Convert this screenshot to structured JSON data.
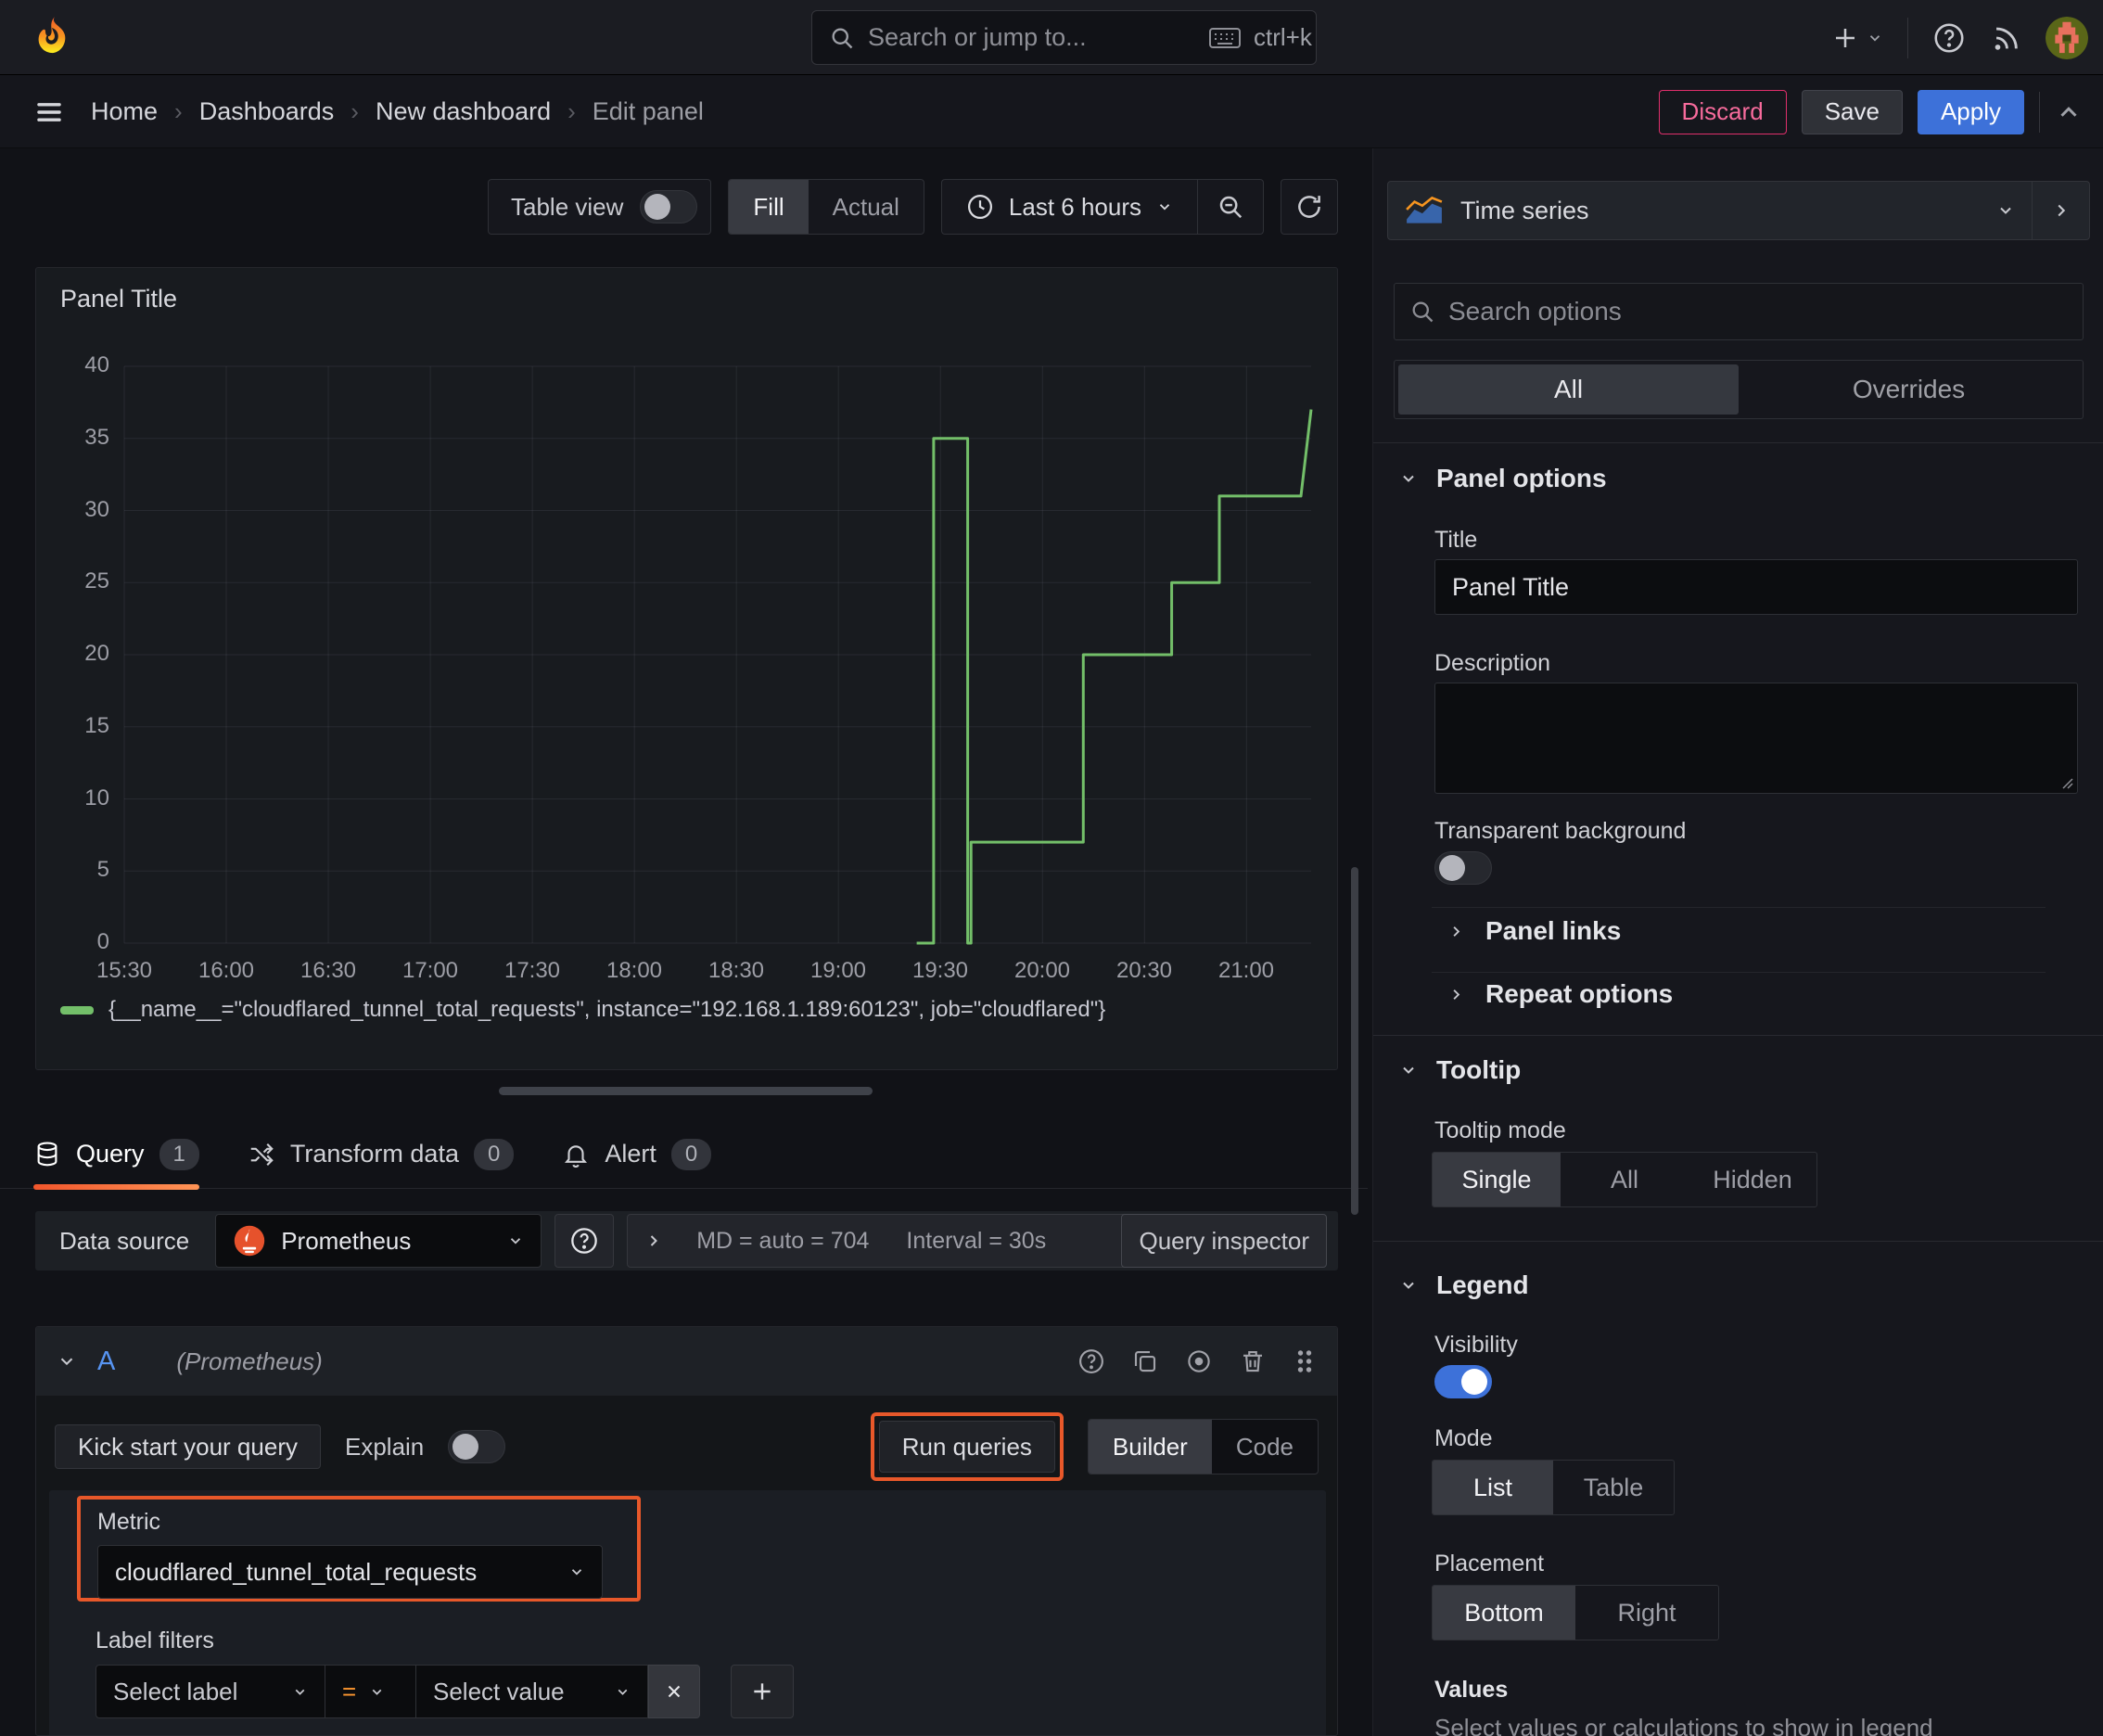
{
  "topbar": {
    "search_placeholder": "Search or jump to...",
    "shortcut": "ctrl+k"
  },
  "breadcrumb": {
    "items": [
      "Home",
      "Dashboards",
      "New dashboard",
      "Edit panel"
    ]
  },
  "header_actions": {
    "discard": "Discard",
    "save": "Save",
    "apply": "Apply"
  },
  "toolbar": {
    "table_view_label": "Table view",
    "fill_label": "Fill",
    "actual_label": "Actual",
    "time_range_label": "Last 6 hours"
  },
  "panel": {
    "title": "Panel Title"
  },
  "chart_data": {
    "type": "line",
    "line_style": "step-after",
    "title": "Panel Title",
    "xlabel": "",
    "ylabel": "",
    "x_ticks": [
      "15:30",
      "16:00",
      "16:30",
      "17:00",
      "17:30",
      "18:00",
      "18:30",
      "19:00",
      "19:30",
      "20:00",
      "20:30",
      "21:00"
    ],
    "x_tick_minutes": [
      0,
      30,
      60,
      90,
      120,
      150,
      180,
      210,
      240,
      270,
      300,
      330
    ],
    "x_range_minutes": [
      0,
      349
    ],
    "y_ticks": [
      0,
      5,
      10,
      15,
      20,
      25,
      30,
      35,
      40
    ],
    "ylim": [
      0,
      40
    ],
    "grid": true,
    "legend_position": "bottom",
    "series": [
      {
        "name": "{__name__=\"cloudflared_tunnel_total_requests\", instance=\"192.168.1.189:60123\", job=\"cloudflared\"}",
        "color": "#73bf69",
        "points_min_value": [
          [
            233,
            0
          ],
          [
            238,
            0
          ],
          [
            238,
            35
          ],
          [
            248,
            35
          ],
          [
            248,
            0
          ],
          [
            249,
            0
          ],
          [
            249,
            7
          ],
          [
            282,
            7
          ],
          [
            282,
            20
          ],
          [
            308,
            20
          ],
          [
            308,
            25
          ],
          [
            322,
            25
          ],
          [
            322,
            31
          ],
          [
            346,
            31
          ],
          [
            349,
            37
          ]
        ]
      }
    ]
  },
  "editor_tabs": {
    "query": {
      "label": "Query",
      "count": "1"
    },
    "transform": {
      "label": "Transform data",
      "count": "0"
    },
    "alert": {
      "label": "Alert",
      "count": "0"
    }
  },
  "datasource_row": {
    "label": "Data source",
    "value": "Prometheus",
    "max_data_points": "MD = auto = 704",
    "interval": "Interval = 30s",
    "inspector": "Query inspector"
  },
  "query_editor": {
    "ref_id": "A",
    "ds_hint": "(Prometheus)",
    "kickstart": "Kick start your query",
    "explain": "Explain",
    "run_queries": "Run queries",
    "builder": "Builder",
    "code": "Code",
    "metric": {
      "label": "Metric",
      "value": "cloudflared_tunnel_total_requests"
    },
    "label_filters": {
      "label": "Label filters",
      "select_label": "Select label",
      "operator": "=",
      "select_value": "Select value"
    }
  },
  "sidebar": {
    "visualization": "Time series",
    "search_placeholder": "Search options",
    "tabs": {
      "all": "All",
      "overrides": "Overrides"
    },
    "panel_options": {
      "header": "Panel options",
      "title_label": "Title",
      "title_value": "Panel Title",
      "description_label": "Description",
      "transparent_label": "Transparent background"
    },
    "panel_links": "Panel links",
    "repeat_options": "Repeat options",
    "tooltip": {
      "header": "Tooltip",
      "mode_label": "Tooltip mode",
      "options": [
        "Single",
        "All",
        "Hidden"
      ],
      "selected": "Single"
    },
    "legend": {
      "header": "Legend",
      "visibility_label": "Visibility",
      "mode_label": "Mode",
      "mode_options": [
        "List",
        "Table"
      ],
      "mode_selected": "List",
      "placement_label": "Placement",
      "placement_options": [
        "Bottom",
        "Right"
      ],
      "placement_selected": "Bottom",
      "values_label": "Values",
      "values_hint": "Select values or calculations to show in legend"
    }
  },
  "colors": {
    "series_green": "#73bf69",
    "accent_orange": "#ff780a",
    "highlight_orange": "#e8582a",
    "primary_blue": "#3d71d9",
    "danger_pink": "#e02f6c",
    "tab_underline_from": "#f2562c",
    "tab_underline_to": "#ff9456"
  }
}
